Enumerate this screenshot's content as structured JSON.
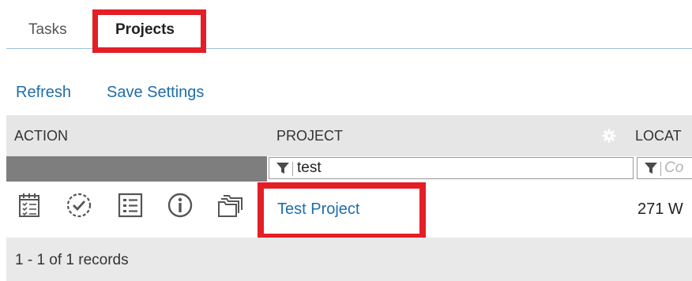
{
  "tabs": {
    "tasks_label": "Tasks",
    "projects_label": "Projects",
    "active": "Projects"
  },
  "toolbar": {
    "refresh_label": "Refresh",
    "save_settings_label": "Save Settings"
  },
  "grid": {
    "columns": {
      "action": "ACTION",
      "project": "PROJECT",
      "location": "LOCAT"
    },
    "filters": {
      "project_value": "test",
      "location_placeholder": "Co"
    },
    "rows": [
      {
        "action_icons": [
          "calendar-list-icon",
          "clock-check-icon",
          "details-list-icon",
          "info-icon",
          "folders-icon"
        ],
        "project": "Test Project",
        "location": "271 W"
      }
    ],
    "footer": {
      "records": "1 - 1 of 1 records"
    }
  },
  "colors": {
    "link": "#1f6ea8",
    "highlight": "#e41e26",
    "header_bg": "#e6e6e6",
    "tab_underline": "#9ec1dd"
  }
}
